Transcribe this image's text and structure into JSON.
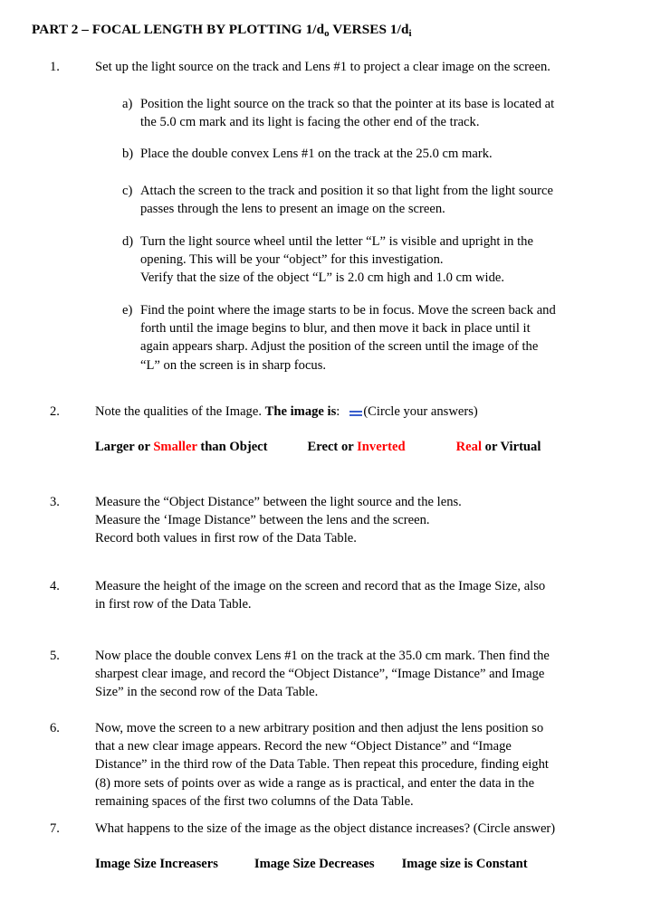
{
  "document": {
    "title_prefix": "PART 2 – FOCAL LENGTH BY PLOTTING 1/d",
    "title_sub1": "o",
    "title_mid": " VERSES 1/d",
    "title_sub2": "i",
    "title_plain": "PART 2 – FOCAL LENGTH BY PLOTTING 1/do VERSES 1/di"
  },
  "colors": {
    "text": "#000000",
    "highlight_red": "#FF0000",
    "mark_blue": "#3A5FCD",
    "background": "#FFFFFF"
  },
  "items": [
    {
      "number": "1.",
      "lines": [
        "Set up the light source on the track and Lens #1 to project a clear image on the screen."
      ],
      "sub_items": [
        {
          "letter": "a)",
          "lines": [
            "Position the light source on the track so that the pointer at its base is located at",
            "the 5.0 cm mark and its light is facing the other end of the track."
          ]
        },
        {
          "letter": "b)",
          "lines": [
            "Place the double convex Lens #1 on the track at the 25.0 cm mark."
          ]
        },
        {
          "letter": "c)",
          "lines": [
            "Attach the screen to the track and position it so that light from the light source",
            "passes through the lens to present an image on the screen."
          ]
        },
        {
          "letter": "d)",
          "lines": [
            "Turn the light source wheel until the letter “L” is visible and upright in the",
            "opening.  This will be your “object” for this investigation.",
            "Verify that the size of the object “L” is 2.0 cm high and 1.0 cm wide."
          ]
        },
        {
          "letter": "e)",
          "lines": [
            "Find the point where the image starts to be in focus.  Move the screen back and",
            "forth until the image begins to blur, and then move it back in place until it",
            "again appears sharp.  Adjust the position of the screen until the image of the",
            "“L” on the screen is in sharp focus."
          ]
        }
      ]
    },
    {
      "number": "2.",
      "lead": "Note the qualities of the Image.  ",
      "bold_phrase": "The image is",
      "after_bold": ":",
      "circle_note": "(Circle your answers)",
      "answers": {
        "group1_pre": "Larger or ",
        "group1_red": "Smaller",
        "group1_post": " than Object",
        "group2_pre": "Erect or ",
        "group2_red": "Inverted",
        "group2_post": "",
        "group3_red": "Real",
        "group3_post": " or Virtual"
      }
    },
    {
      "number": "3.",
      "lines": [
        "Measure the “Object Distance” between the light source and the lens.",
        "Measure the ‘Image Distance” between the lens and the screen.",
        "Record both values in first row of the Data Table."
      ]
    },
    {
      "number": "4.",
      "lines": [
        "Measure the height of the image on the screen and record that as the Image Size, also",
        "in first row of the Data Table."
      ]
    },
    {
      "number": "5.",
      "lines": [
        "Now place the double convex Lens #1 on the track at the 35.0 cm mark.  Then find the",
        "sharpest clear image, and record the “Object Distance”, “Image Distance” and Image",
        "Size” in the second row of the Data Table."
      ]
    },
    {
      "number": "6.",
      "lines": [
        "Now, move the screen to a new arbitrary position and then adjust the lens position so",
        "that a new clear image appears.   Record the new “Object Distance” and “Image",
        "Distance” in the third row of the Data Table.  Then repeat this procedure, finding eight",
        "(8) more sets of points over as wide a range as is practical, and enter the data in the",
        "remaining spaces of the first two columns of the Data Table."
      ]
    },
    {
      "number": "7.",
      "lines": [
        "What happens to the size of the image as the object distance increases? (Circle answer)"
      ],
      "answers": {
        "choice1": "Image Size Increasers",
        "choice2": "Image Size Decreases",
        "choice3": "Image size is Constant"
      }
    }
  ]
}
